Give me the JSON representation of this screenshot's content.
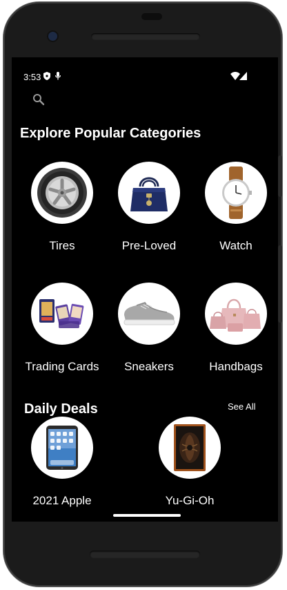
{
  "status_bar": {
    "time": "3:53"
  },
  "search": {
    "icon": "search-icon"
  },
  "categories_section": {
    "title": "Explore Popular Categories",
    "items": [
      {
        "label": "Tires",
        "icon": "tire-image"
      },
      {
        "label": "Pre-Loved",
        "icon": "purse-image"
      },
      {
        "label": "Watch",
        "icon": "watch-image"
      },
      {
        "label": "Trading Cards",
        "icon": "trading-cards-image"
      },
      {
        "label": "Sneakers",
        "icon": "sneaker-image"
      },
      {
        "label": "Handbags",
        "icon": "handbags-image"
      }
    ]
  },
  "daily_deals": {
    "title": "Daily Deals",
    "see_all": "See All",
    "items": [
      {
        "label": "2021 Apple",
        "icon": "tablet-image"
      },
      {
        "label": "Yu-Gi-Oh",
        "icon": "card-image"
      }
    ]
  },
  "colors": {
    "background": "#000000",
    "text": "#ffffff",
    "circle": "#ffffff"
  }
}
